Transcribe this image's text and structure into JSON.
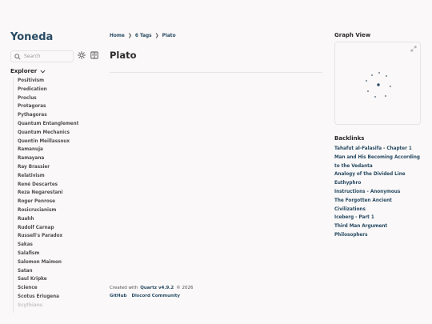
{
  "site": {
    "title": "Yoneda"
  },
  "search": {
    "placeholder": "Search"
  },
  "icons": {
    "search": "search-icon",
    "theme": "sun-icon",
    "reader": "reader-mode-icon",
    "explorer_toggle": "chevron-down-icon",
    "expand_graph": "expand-icon"
  },
  "explorer": {
    "title": "Explorer",
    "items": [
      "Positivism",
      "Predication",
      "Proclus",
      "Protagoras",
      "Pythagoras",
      "Quantum Entanglement",
      "Quantum Mechanics",
      "Quentin Meillassoux",
      "Ramanuja",
      "Ramayana",
      "Ray Brassier",
      "Relativism",
      "René Descartes",
      "Reza Negarestani",
      "Roger Penrose",
      "Rosicrucianism",
      "Ruahh",
      "Rudolf Carnap",
      "Russell's Paradox",
      "Sakas",
      "Salafism",
      "Salomon Maimon",
      "Satan",
      "Saul Kripke",
      "Science",
      "Scotus Eriugena",
      "Scythians"
    ]
  },
  "breadcrumb": {
    "home": "Home",
    "tags": "6 Tags",
    "current": "Plato",
    "separator": "❯"
  },
  "page": {
    "title": "Plato"
  },
  "footer": {
    "created_with": "Created with",
    "quartz": "Quartz v4.9.2",
    "year": "© 2026",
    "links": [
      "GitHub",
      "Discord Community"
    ]
  },
  "graph": {
    "title": "Graph View"
  },
  "backlinks": {
    "title": "Backlinks",
    "items": [
      "Tahafut al-Falasifa - Chapter 1",
      "Man and His Becoming According to the Vedanta",
      "Analogy of the Divided Line",
      "Euthyphro",
      "Instructions - Anonymous",
      "The Forgotten Ancient Civilizations",
      "Iceberg - Part 1",
      "Third Man Argument",
      "Philosophers"
    ]
  },
  "colors": {
    "accent": "#284b63",
    "background": "#faf8f8",
    "text": "#2b2b2b",
    "border": "#e5e5e5",
    "graph_node": "#6b7d8f"
  }
}
